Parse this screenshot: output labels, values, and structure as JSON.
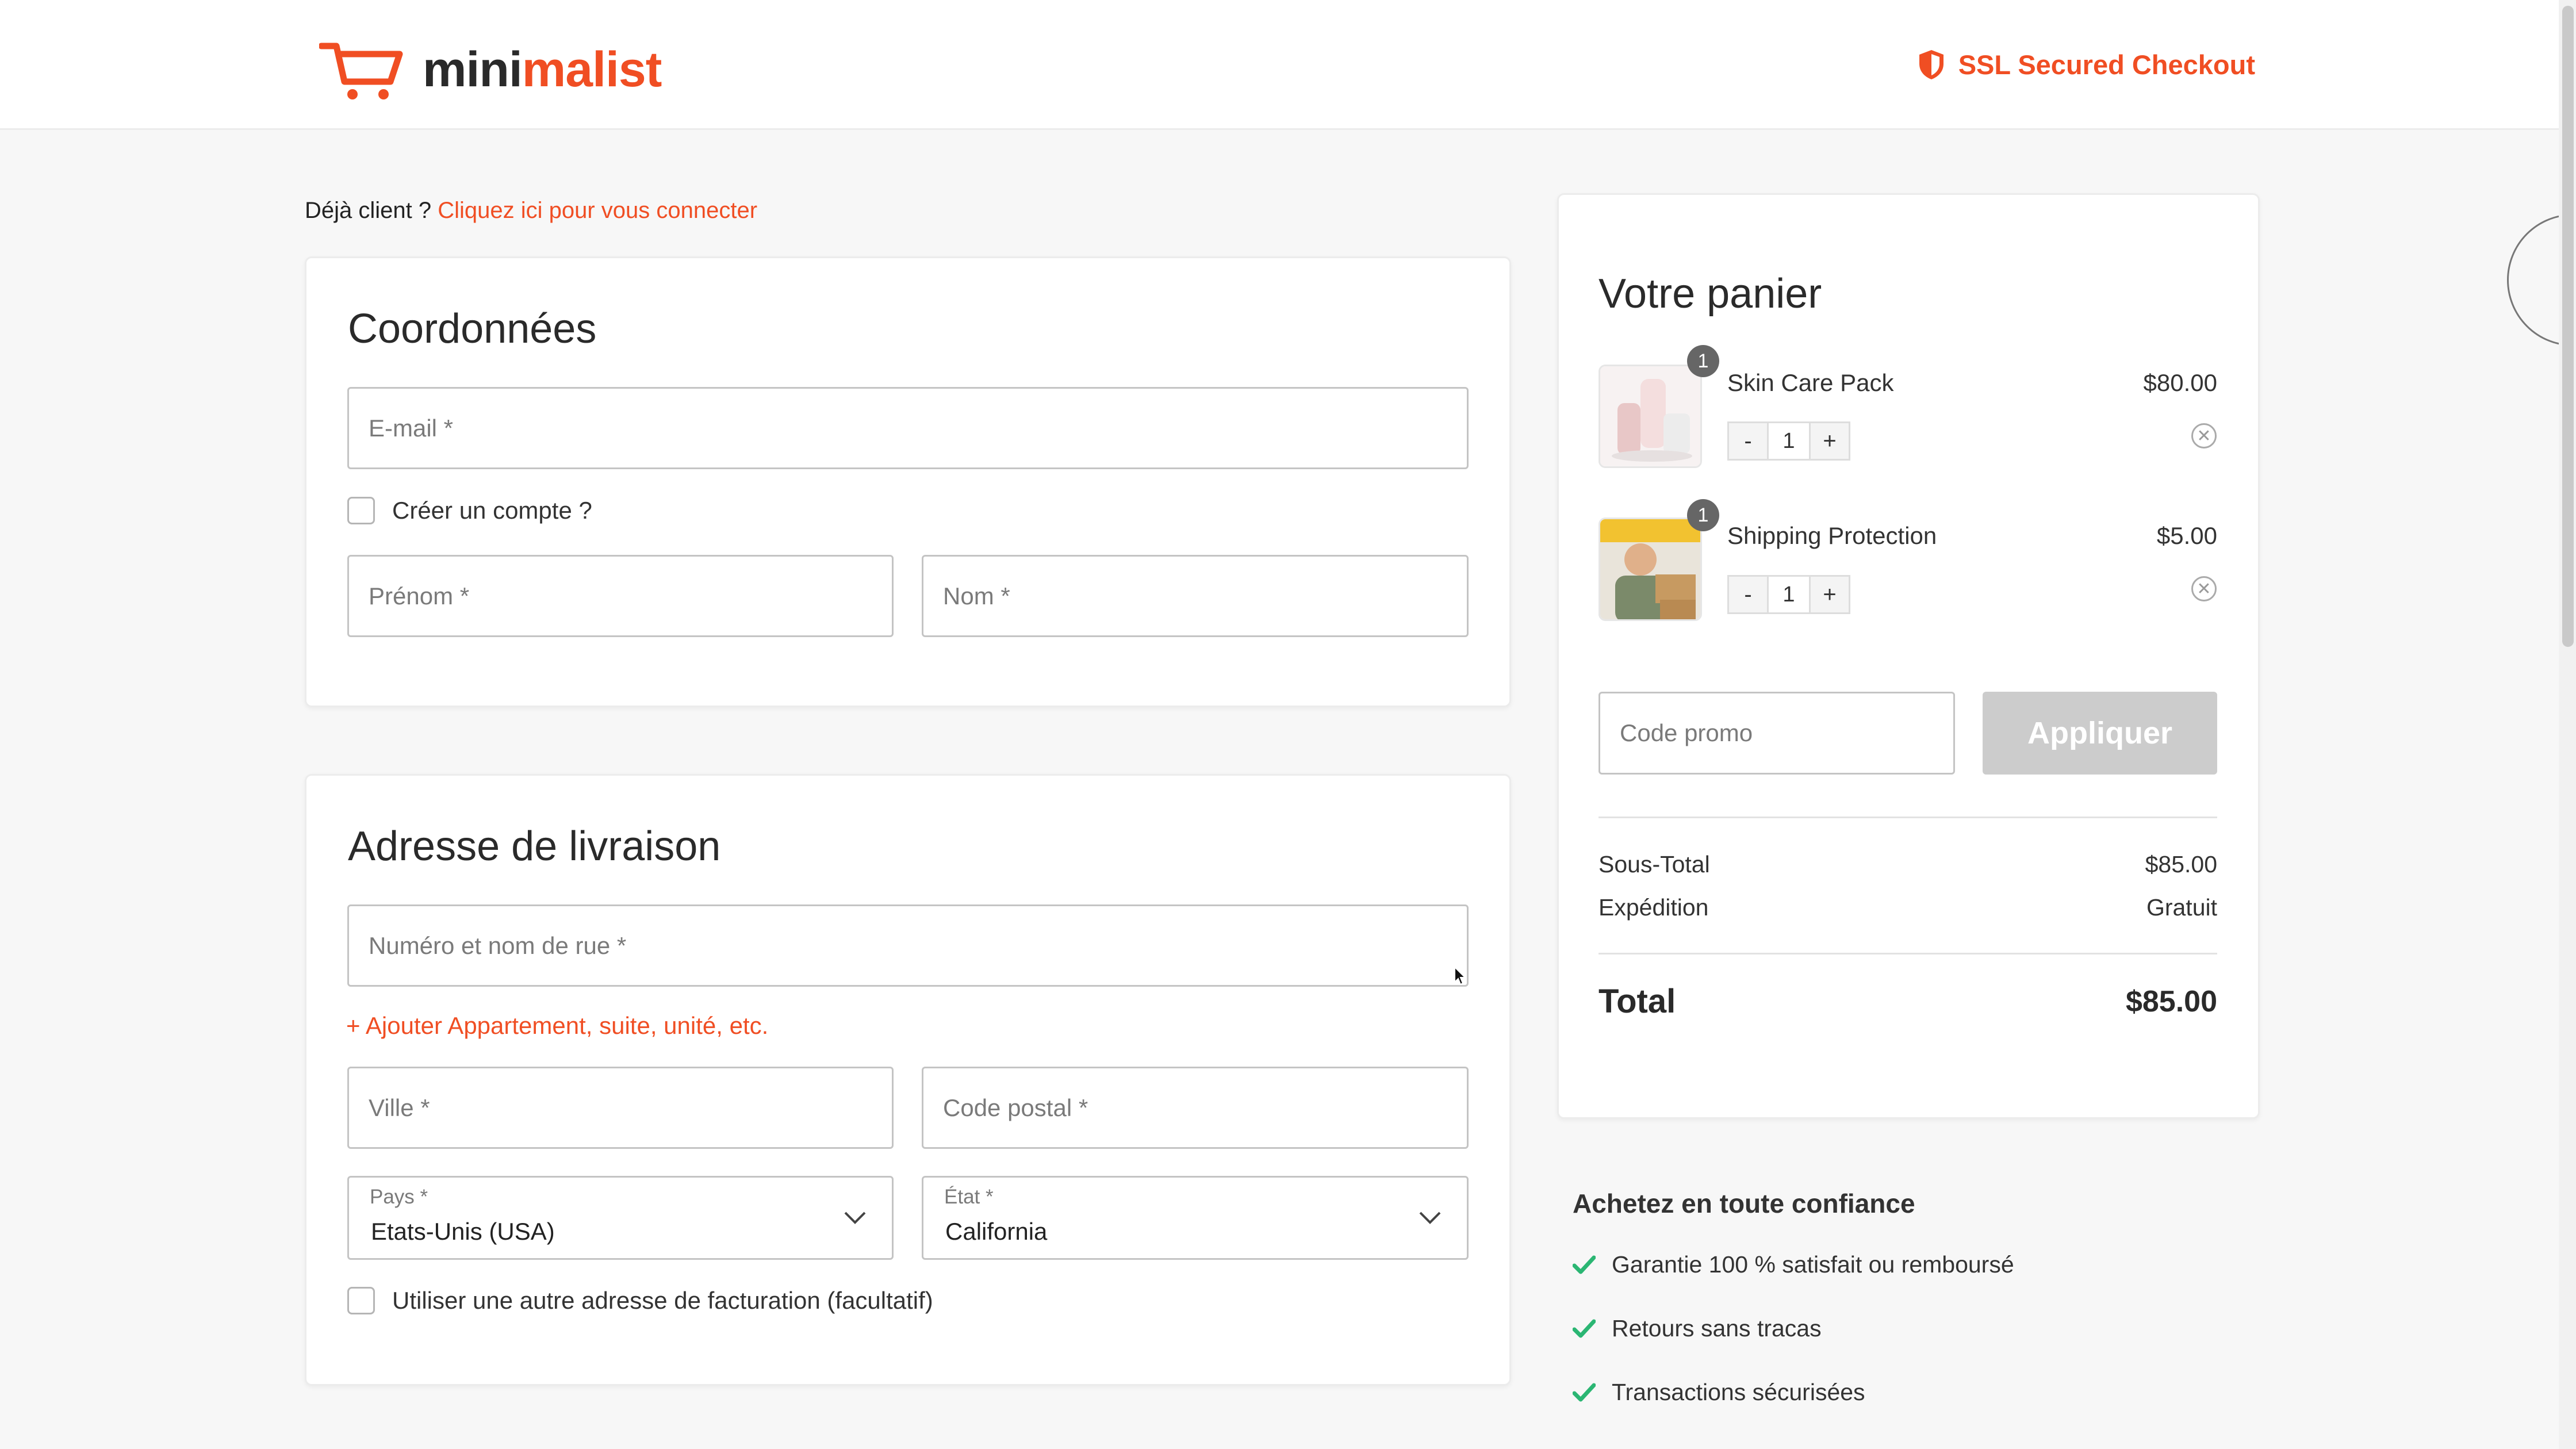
{
  "header": {
    "logo_part1": "mini",
    "logo_part2": "malist",
    "ssl_text": "SSL Secured Checkout"
  },
  "login_prompt": {
    "text": "Déjà client ? ",
    "link": "Cliquez ici pour vous connecter"
  },
  "contact": {
    "title": "Coordonnées",
    "email_placeholder": "E-mail *",
    "create_account": "Créer un compte ?",
    "first_name_placeholder": "Prénom *",
    "last_name_placeholder": "Nom *"
  },
  "shipping": {
    "title": "Adresse de livraison",
    "street_placeholder": "Numéro et nom de rue *",
    "add_apartment": "+ Ajouter Appartement, suite, unité, etc.",
    "city_placeholder": "Ville *",
    "zip_placeholder": "Code postal *",
    "country_label": "Pays *",
    "country_value": "Etats-Unis (USA)",
    "state_label": "État *",
    "state_value": "California",
    "other_billing": "Utiliser une autre adresse de facturation (facultatif)"
  },
  "cart": {
    "title": "Votre panier",
    "items": [
      {
        "name": "Skin Care Pack",
        "price": "$80.00",
        "qty": "1",
        "badge": "1",
        "minus": "-",
        "plus": "+"
      },
      {
        "name": "Shipping Protection",
        "price": "$5.00",
        "qty": "1",
        "badge": "1",
        "minus": "-",
        "plus": "+"
      }
    ],
    "promo_placeholder": "Code promo",
    "apply_label": "Appliquer",
    "subtotal_label": "Sous-Total",
    "subtotal_value": "$85.00",
    "shipping_label": "Expédition",
    "shipping_value": "Gratuit",
    "total_label": "Total",
    "total_value": "$85.00"
  },
  "trust": {
    "title": "Achetez en toute confiance",
    "items": [
      "Garantie 100 % satisfait ou remboursé",
      "Retours sans tracas",
      "Transactions sécurisées"
    ]
  },
  "colors": {
    "accent": "#f04e23",
    "check": "#2bb673",
    "button_disabled": "#cccccc"
  }
}
